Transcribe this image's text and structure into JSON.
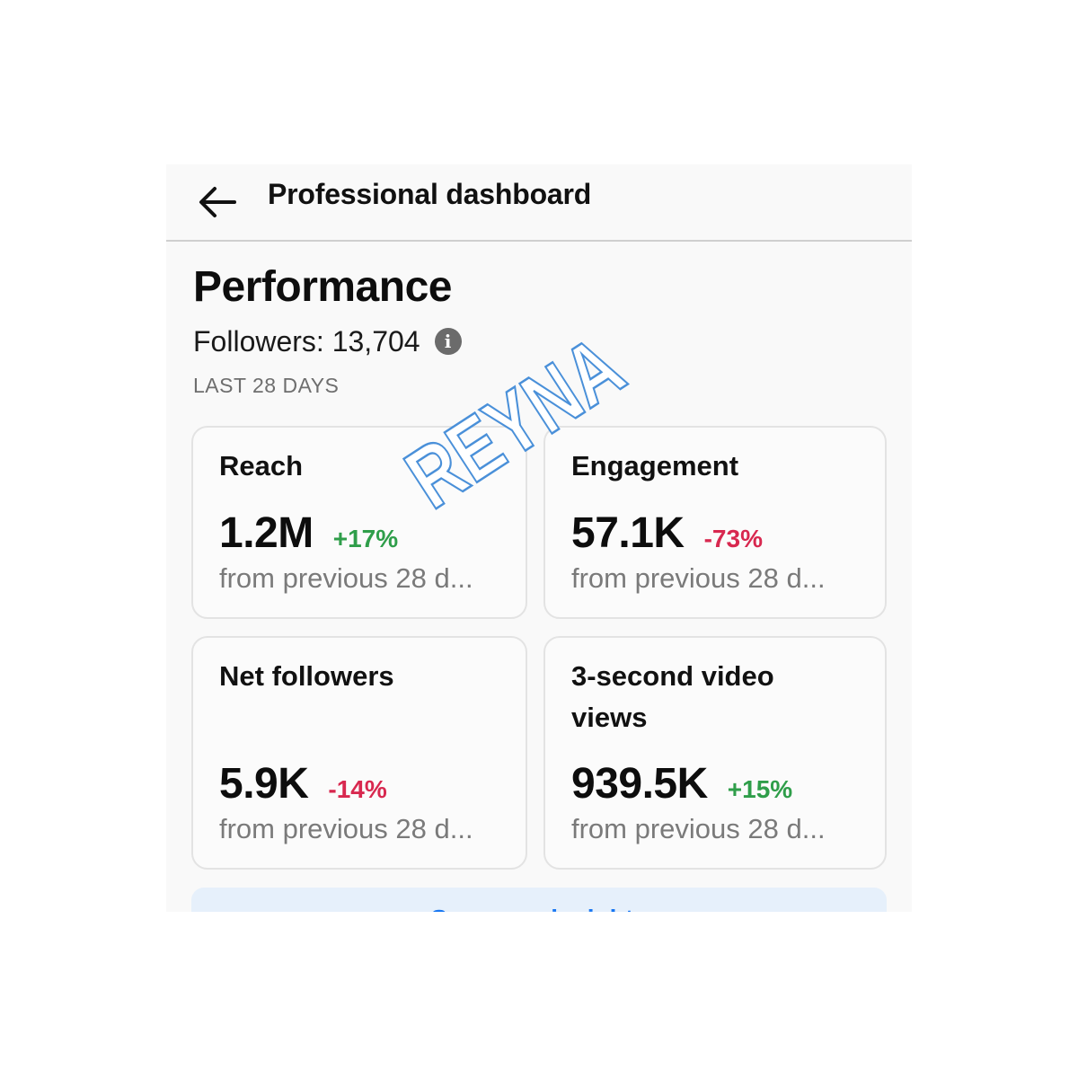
{
  "header": {
    "back_icon": "arrow-left-icon",
    "title": "Professional dashboard"
  },
  "performance": {
    "title": "Performance",
    "followers_label": "Followers: 13,704",
    "info_icon": "info-icon",
    "info_glyph": "i",
    "period": "LAST 28 DAYS"
  },
  "cards": [
    {
      "label": "Reach",
      "value": "1.2M",
      "change": "+17%",
      "direction": "up",
      "sub": "from previous 28 d..."
    },
    {
      "label": "Engagement",
      "value": "57.1K",
      "change": "-73%",
      "direction": "down",
      "sub": "from previous 28 d..."
    },
    {
      "label": "Net followers",
      "value": "5.9K",
      "change": "-14%",
      "direction": "down",
      "sub": "from previous 28 d..."
    },
    {
      "label": "3-second video views",
      "value": "939.5K",
      "change": "+15%",
      "direction": "up",
      "sub": "from previous 28 d..."
    }
  ],
  "bottom_banner": {
    "text": "See more insights"
  },
  "watermark": {
    "text": "REYNA"
  },
  "colors": {
    "positive": "#2f9e4a",
    "negative": "#d8284f",
    "watermark": "#4a90d9"
  }
}
